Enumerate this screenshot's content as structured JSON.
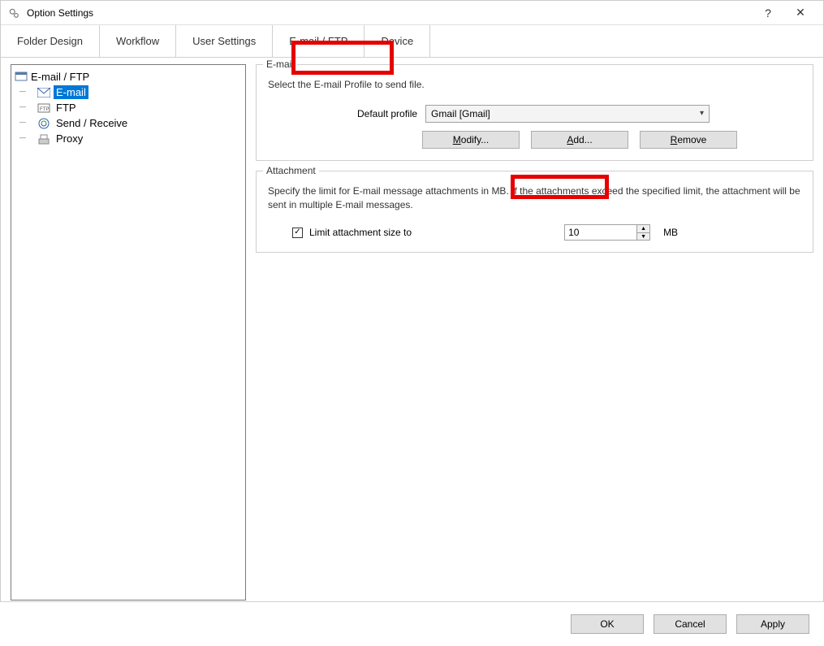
{
  "window": {
    "title": "Option Settings",
    "help": "?",
    "close": "✕"
  },
  "tabs": [
    {
      "label": "Folder Design"
    },
    {
      "label": "Workflow"
    },
    {
      "label": "User Settings"
    },
    {
      "label": "E-mail / FTP",
      "active": true
    },
    {
      "label": "Device"
    }
  ],
  "tree": {
    "root": "E-mail / FTP",
    "items": [
      {
        "label": "E-mail",
        "selected": true,
        "icon": "envelope"
      },
      {
        "label": "FTP",
        "icon": "ftp"
      },
      {
        "label": "Send / Receive",
        "icon": "sendreceive"
      },
      {
        "label": "Proxy",
        "icon": "proxy"
      }
    ]
  },
  "email": {
    "legend": "E-mail",
    "desc": "Select the E-mail Profile to send file.",
    "profile_label": "Default profile",
    "profile_value": "Gmail [Gmail]",
    "modify_prefix": "M",
    "modify_rest": "odify...",
    "add_prefix": "A",
    "add_rest": "dd...",
    "remove_prefix": "R",
    "remove_rest": "emove"
  },
  "attachment": {
    "legend": "Attachment",
    "desc": "Specify the limit for E-mail message attachments in MB. If the attachments exceed the specified limit, the attachment will be sent in multiple E-mail messages.",
    "checkbox_label": "Limit attachment size to",
    "checked": true,
    "value": "10",
    "unit": "MB"
  },
  "footer": {
    "ok": "OK",
    "cancel": "Cancel",
    "apply": "Apply"
  }
}
